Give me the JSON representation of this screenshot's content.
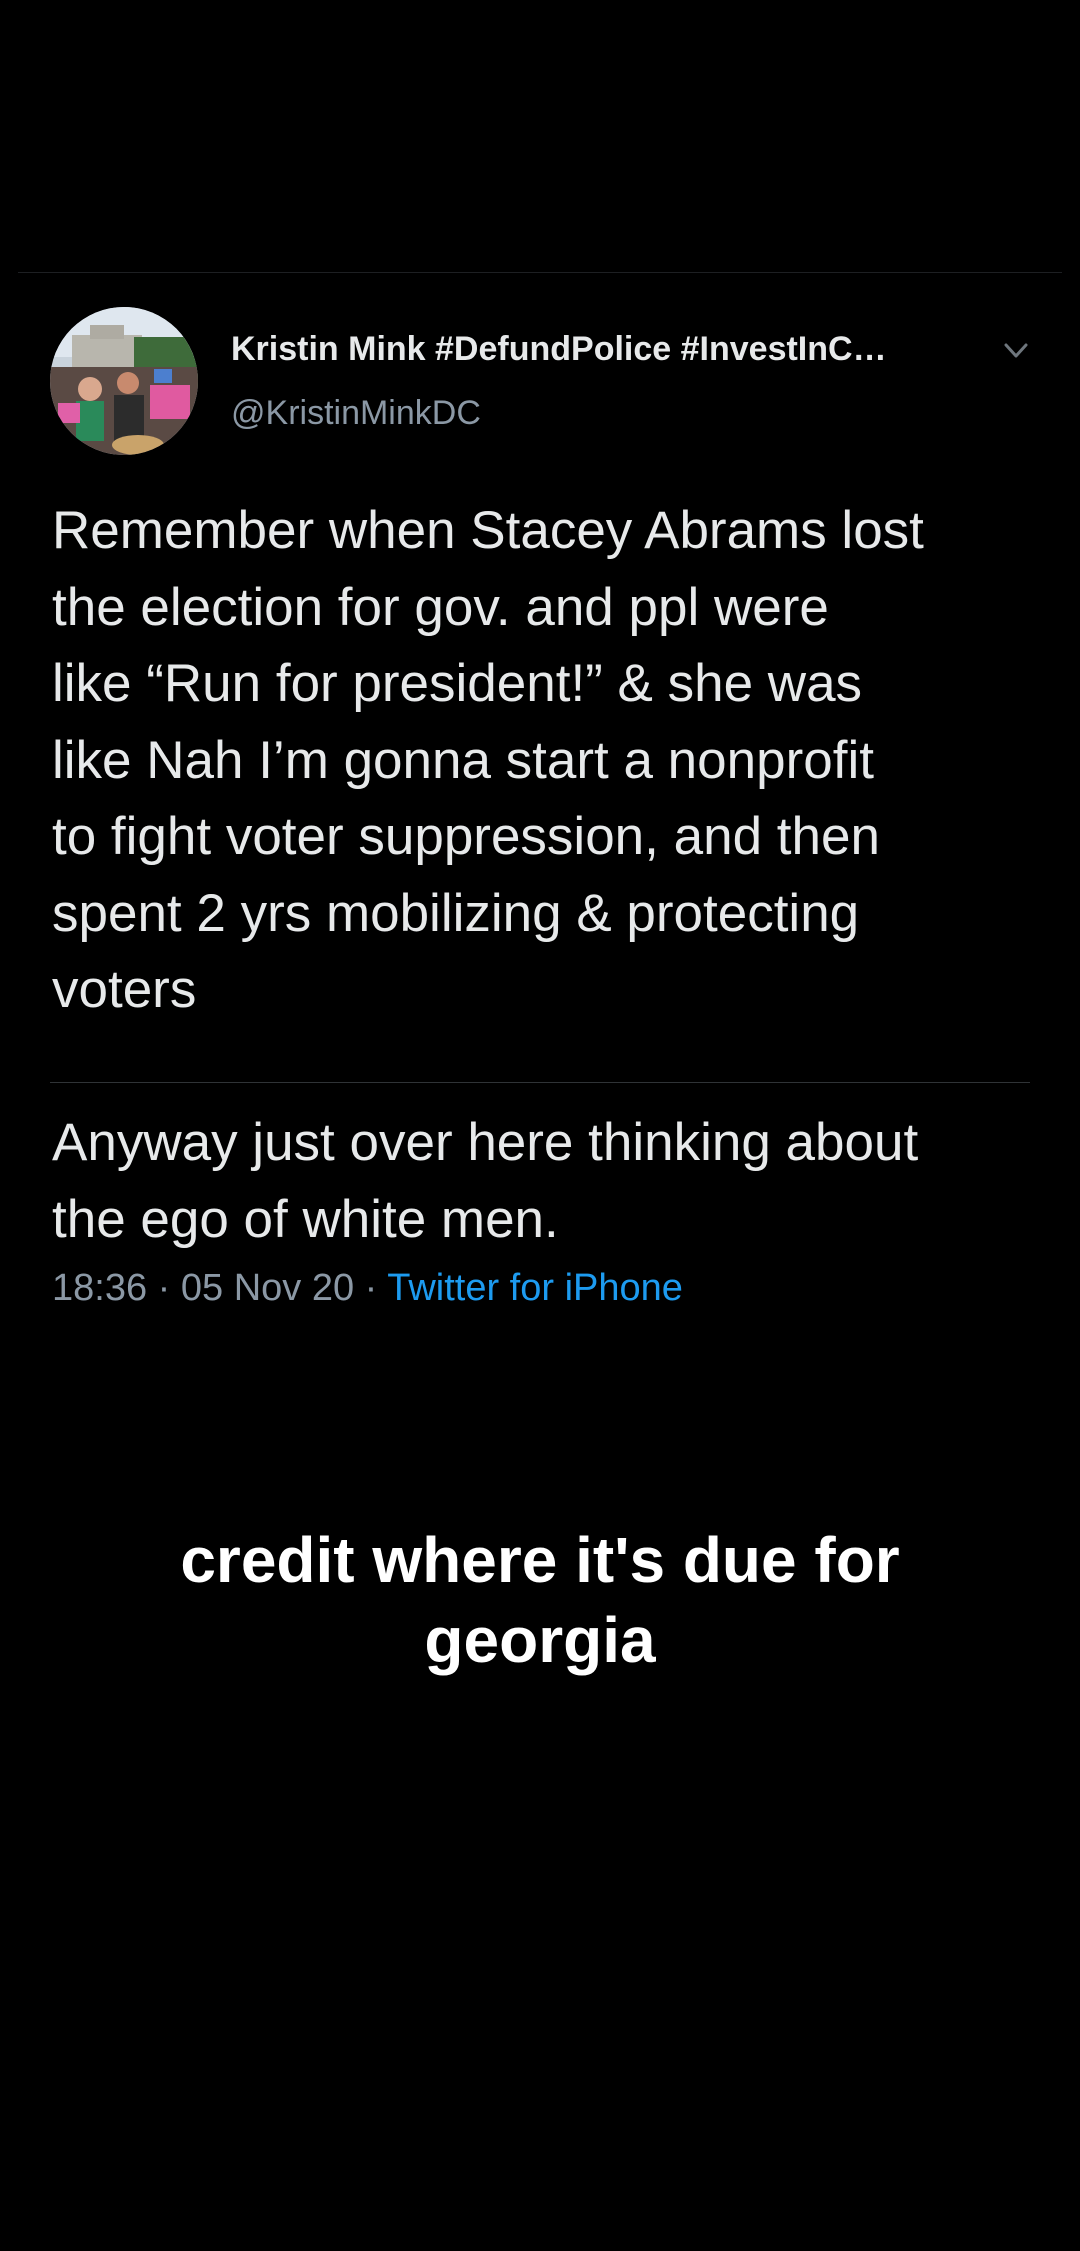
{
  "tweet": {
    "display_name": "Kristin Mink #DefundPolice #InvestInC…",
    "handle": "@KristinMinkDC",
    "body_lines_1": "Remember when Stacey Abrams lost\nthe election for gov. and ppl were\nlike “Run for president!” & she was\nlike Nah I’m gonna start a nonprofit\nto fight voter suppression, and then\nspent 2 yrs mobilizing & protecting\nvoters",
    "body_lines_2": "Anyway just over here thinking about\nthe ego of white men.",
    "time": "18:36",
    "date": "05 Nov 20",
    "separator": "·",
    "source": "Twitter for iPhone"
  },
  "caption": {
    "line1": "credit where it's due for",
    "line2": "georgia"
  },
  "icons": {
    "avatar": "profile-photo",
    "menu": "chevron-down-icon"
  },
  "colors": {
    "background": "#000000",
    "text": "#e7e9ea",
    "secondary": "#8b98a5",
    "link": "#1d9bf0"
  }
}
